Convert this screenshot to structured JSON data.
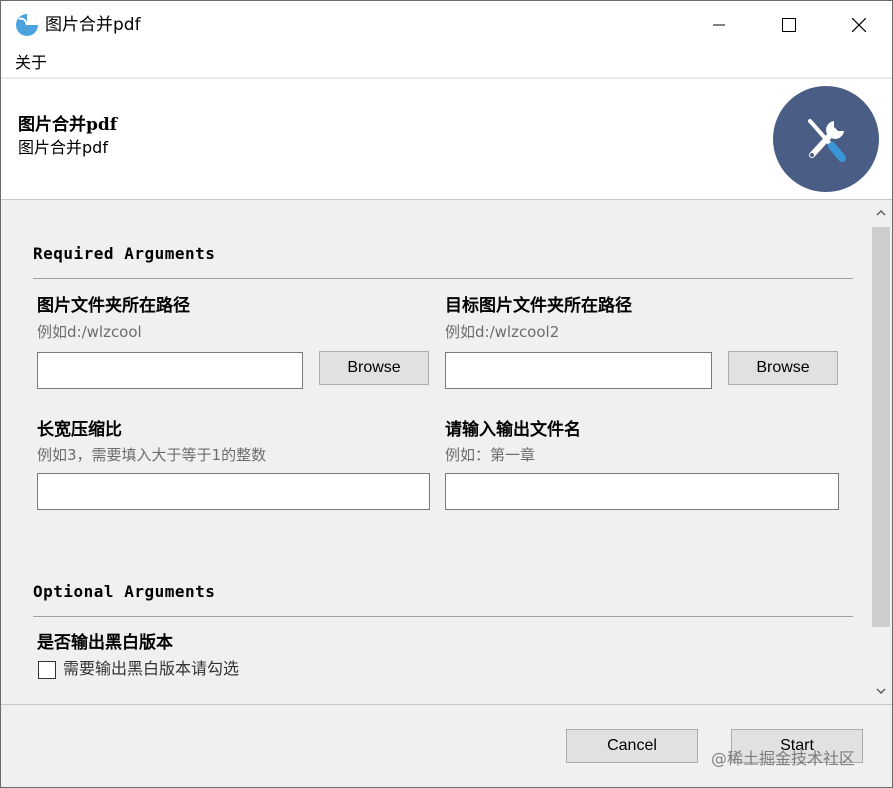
{
  "window": {
    "title": "图片合并pdf",
    "controls": {
      "minimize": "minimize",
      "maximize": "maximize",
      "close": "close"
    }
  },
  "menu": {
    "items": [
      {
        "label": "关于"
      }
    ]
  },
  "header": {
    "title": "图片合并pdf",
    "subtitle": "图片合并pdf",
    "logo_icon": "tools-icon",
    "logo_bg": "#4a5d85"
  },
  "required": {
    "title": "Required Arguments",
    "fields": [
      {
        "label": "图片文件夹所在路径",
        "help": "例如d:/wlzcool",
        "value": "",
        "browse_label": "Browse"
      },
      {
        "label": "目标图片文件夹所在路径",
        "help": "例如d:/wlzcool2",
        "value": "",
        "browse_label": "Browse"
      },
      {
        "label": "长宽压缩比",
        "help": "例如3，需要填入大于等于1的整数",
        "value": ""
      },
      {
        "label": "请输入输出文件名",
        "help": "例如：第一章",
        "value": ""
      }
    ]
  },
  "optional": {
    "title": "Optional Arguments",
    "fields": [
      {
        "label": "是否输出黑白版本",
        "checkbox_label": "需要输出黑白版本请勾选",
        "checked": false
      }
    ]
  },
  "footer": {
    "cancel_label": "Cancel",
    "start_label": "Start",
    "watermark": "@稀土掘金技术社区"
  }
}
